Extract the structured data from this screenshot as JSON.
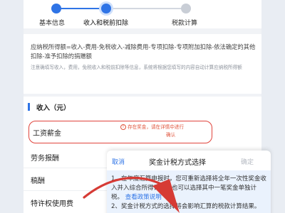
{
  "stepper": {
    "steps": [
      {
        "label": "基本信息",
        "state": "done"
      },
      {
        "label": "收入和税前扣除",
        "state": "current"
      },
      {
        "label": "税款计算",
        "state": "todo"
      }
    ]
  },
  "formula": {
    "main": "应纳税所得额=收入-费用-免税收入-减除费用-专项扣除-专项附加扣除-依法确定的其他扣除-准予扣除的捐赠额",
    "note": "注意确填写收入，费用，免税收入和税前扣除等信息，系统将根据您填写的内容自动计算应纳税所得额"
  },
  "income": {
    "section_title": "收入（元）",
    "salary": {
      "label": "工资薪金",
      "notice": "存在奖金，请在详情中进行",
      "confirm": "确认"
    },
    "rows": [
      {
        "label": "劳务报酬"
      },
      {
        "label": "稿酬"
      },
      {
        "label": "特许权使用费"
      }
    ]
  },
  "sheet": {
    "cancel": "取消",
    "title": "奖金计税方式选择",
    "confirm": "确定",
    "para1": "1、在年度汇算申报时，您可重新选择将全年一次性奖金收入并入综合所得计税，也可以选择其中一笔奖金单独计税。",
    "link": "查看政策说明",
    "para2": "2、奖金计税方式的选择将会影响汇算的税款计算结果。"
  },
  "colors": {
    "accent": "#2f74e6",
    "alert": "#e0443c",
    "arrow": "#d63b35"
  }
}
